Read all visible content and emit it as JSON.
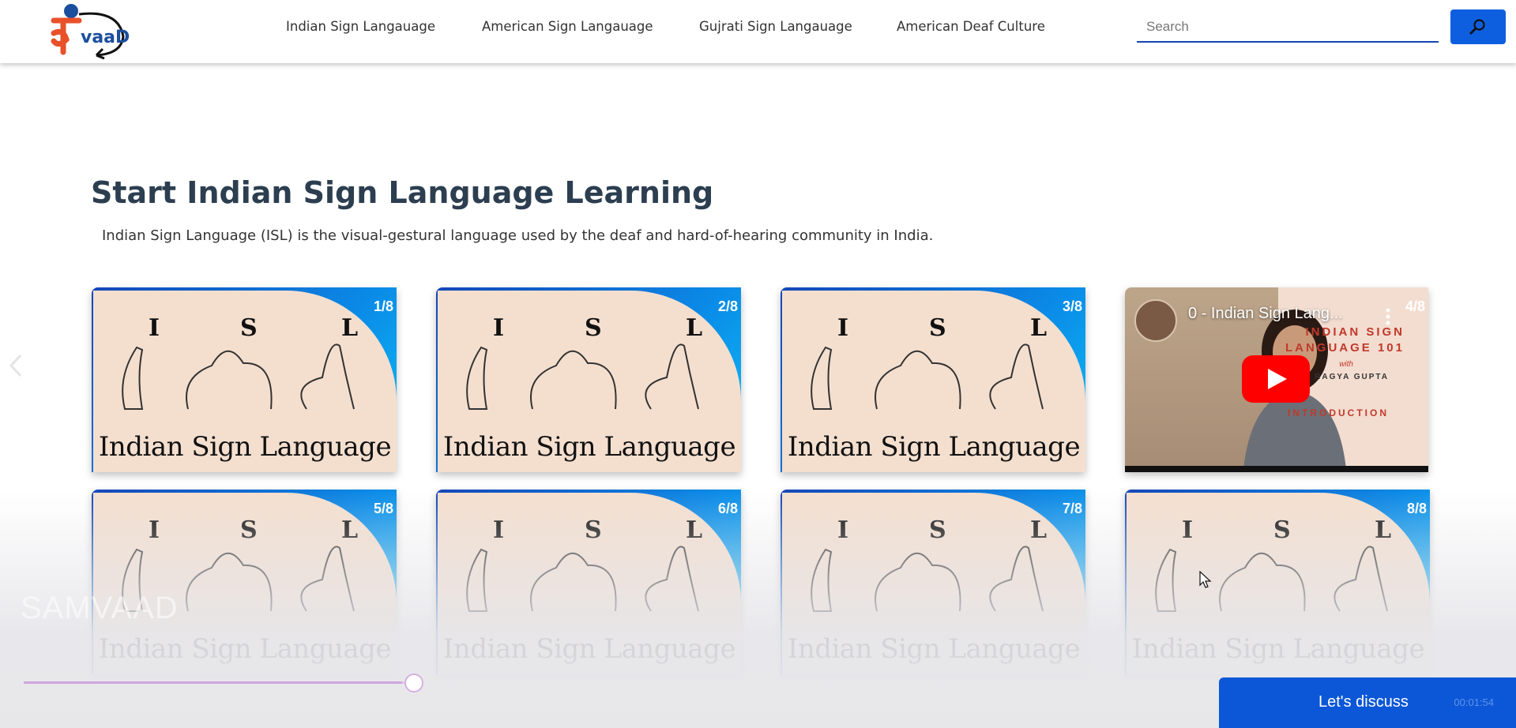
{
  "header": {
    "nav": [
      {
        "label": "Indian Sign Langauage"
      },
      {
        "label": "American Sign Langauage"
      },
      {
        "label": "Gujrati Sign Langauage"
      },
      {
        "label": "American Deaf Culture"
      }
    ],
    "search": {
      "placeholder": "Search",
      "value": ""
    },
    "search_icon": "search-icon"
  },
  "main": {
    "title": "Start Indian Sign Language Learning",
    "description": "Indian Sign Language (ISL) is the visual-gestural language used by the deaf and hard-of-hearing community in India."
  },
  "cards": [
    {
      "badge": "1/8",
      "letters": [
        "I",
        "S",
        "L"
      ],
      "caption": "Indian Sign Language"
    },
    {
      "badge": "2/8",
      "letters": [
        "I",
        "S",
        "L"
      ],
      "caption": "Indian Sign Language"
    },
    {
      "badge": "3/8",
      "letters": [
        "I",
        "S",
        "L"
      ],
      "caption": "Indian Sign Language"
    },
    {
      "badge": "4/8",
      "video_title": "0 - Indian Sign Lang...",
      "overlay_lines": [
        "INDIAN SIGN",
        "LANGUAGE 101",
        "with",
        "RAGYA GUPTA",
        "INTRODUCTION"
      ]
    },
    {
      "badge": "5/8",
      "letters": [
        "I",
        "S",
        "L"
      ],
      "caption": "Indian Sign Language"
    },
    {
      "badge": "6/8",
      "letters": [
        "I",
        "S",
        "L"
      ],
      "caption": "Indian Sign Language"
    },
    {
      "badge": "7/8",
      "letters": [
        "I",
        "S",
        "L"
      ],
      "caption": "Indian Sign Language"
    },
    {
      "badge": "8/8",
      "letters": [
        "I",
        "S",
        "L"
      ],
      "caption": "Indian Sign Language"
    }
  ],
  "footer": {
    "watermark": "SAMVAAD",
    "discuss_label": "Let's discuss",
    "timer": "00:01:54",
    "slider_progress": 0.97
  },
  "colors": {
    "accent": "#0b57d8",
    "card_bg": "#f4dfcf",
    "heading": "#2c3e50"
  }
}
